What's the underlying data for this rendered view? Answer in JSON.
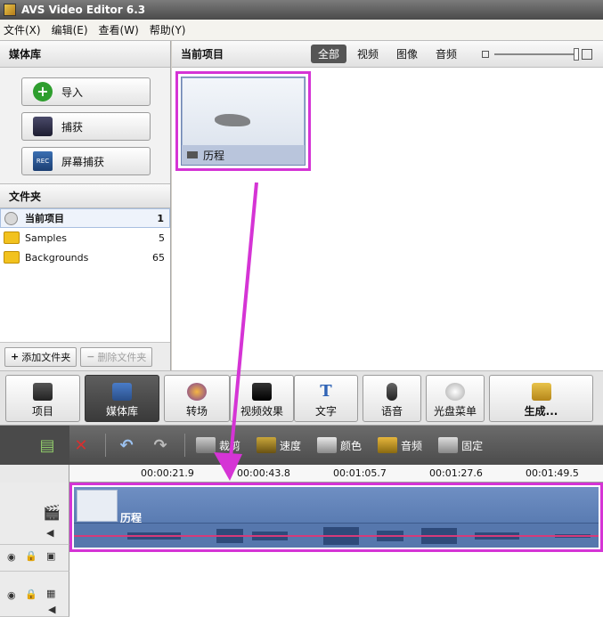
{
  "window": {
    "title": "AVS Video Editor 6.3"
  },
  "menu": [
    "文件(X)",
    "编辑(E)",
    "查看(W)",
    "帮助(Y)"
  ],
  "media_library": {
    "header": "媒体库",
    "buttons": [
      {
        "label": "导入",
        "icon": "plus-icon"
      },
      {
        "label": "捕获",
        "icon": "camera-icon"
      },
      {
        "label": "屏幕捕获",
        "icon": "screen-capture-icon"
      }
    ],
    "folder_header": "文件夹",
    "folders": [
      {
        "name": "当前项目",
        "count": "1",
        "selected": true
      },
      {
        "name": "Samples",
        "count": "5"
      },
      {
        "name": "Backgrounds",
        "count": "65"
      }
    ],
    "add_folder": "添加文件夹",
    "remove_folder": "删除文件夹"
  },
  "project": {
    "header": "当前项目",
    "filters": [
      "全部",
      "视频",
      "图像",
      "音频"
    ],
    "active_filter": "全部",
    "clip_title": "历程"
  },
  "func_toolbar": [
    {
      "label": "项目"
    },
    {
      "label": "媒体库"
    },
    {
      "label": "转场"
    },
    {
      "label": "视频效果"
    },
    {
      "label": "文字"
    },
    {
      "label": "语音"
    },
    {
      "label": "光盘菜单"
    },
    {
      "label": "生成..."
    }
  ],
  "timeline_tools": [
    "裁剪",
    "速度",
    "颜色",
    "音频",
    "固定"
  ],
  "ruler_ticks": [
    "00:00:21.9",
    "00:00:43.8",
    "00:01:05.7",
    "00:01:27.6",
    "00:01:49.5"
  ],
  "timeline_clip_title": "历程",
  "colors": {
    "highlight": "#d534d5",
    "clip_blue": "#5677ad",
    "audio_line": "#d63a7a"
  }
}
